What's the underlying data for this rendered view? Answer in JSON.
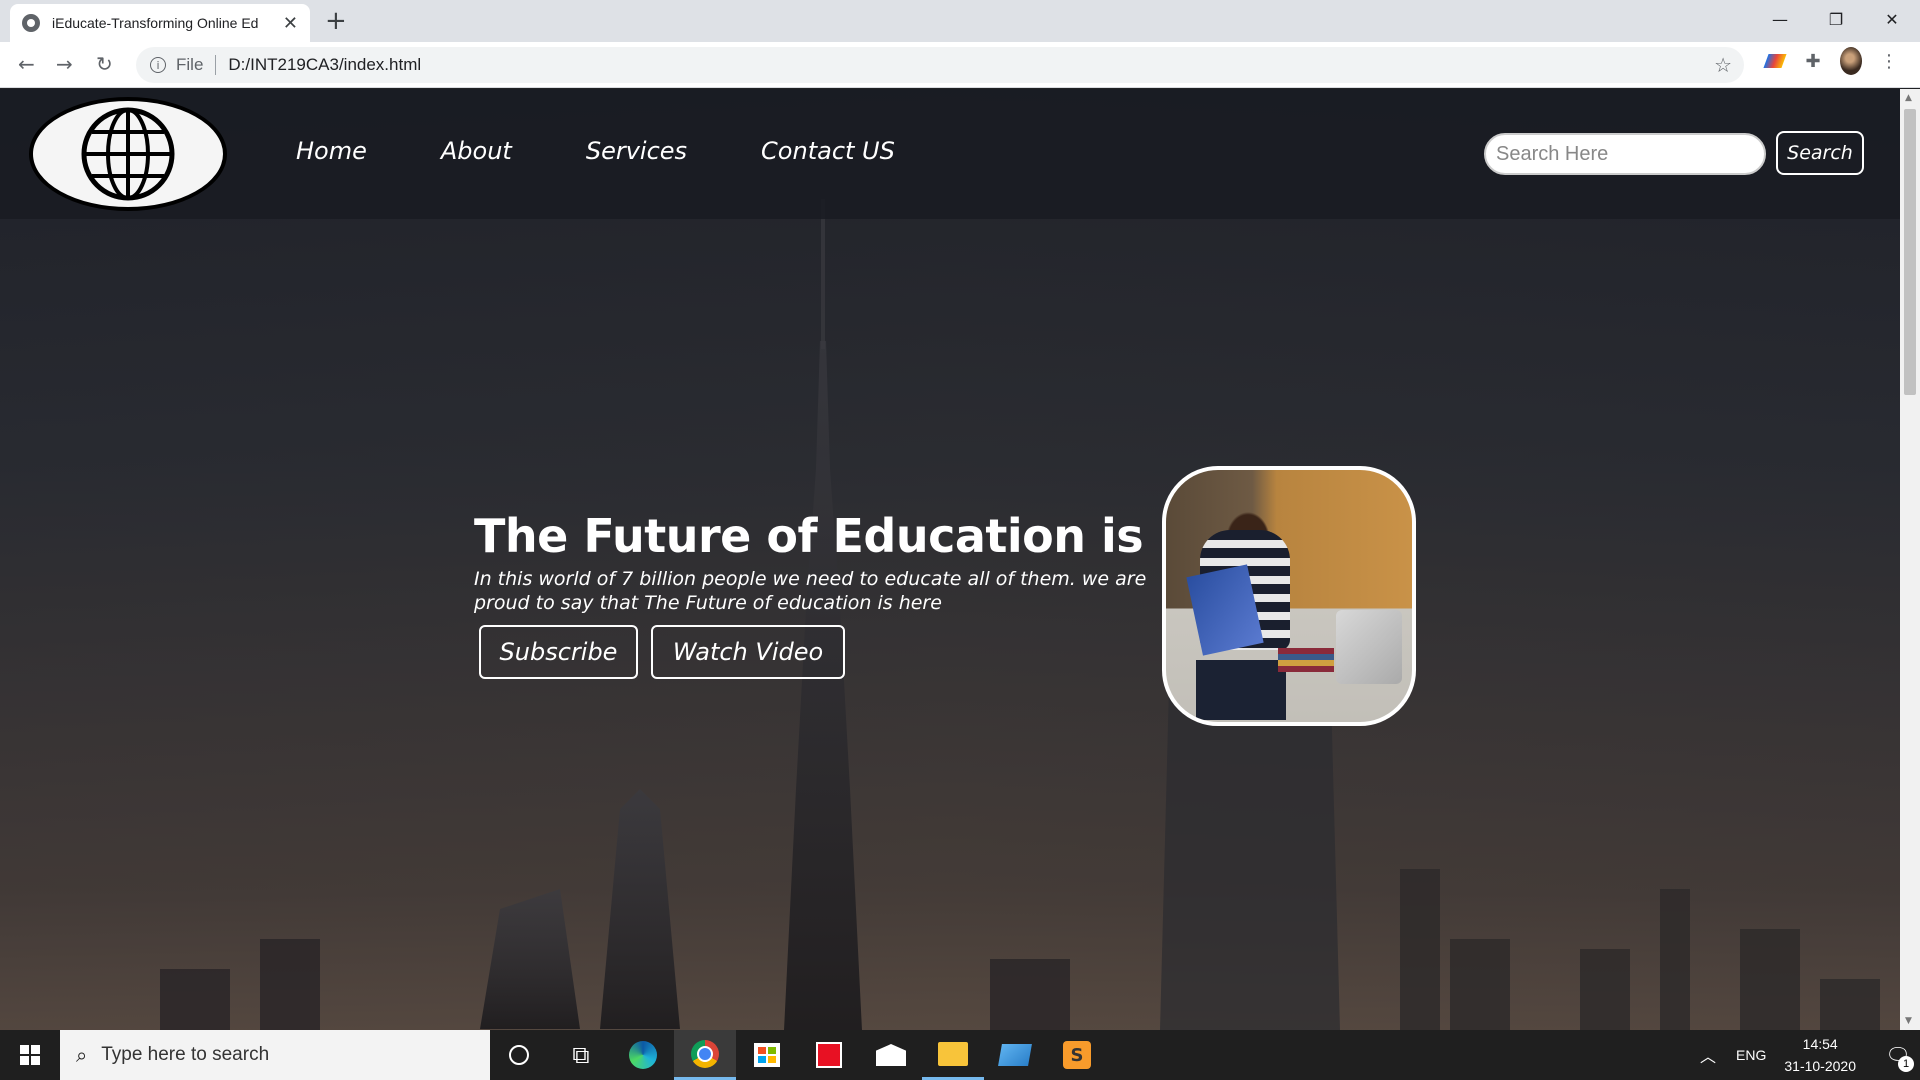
{
  "browser": {
    "tab_title": "iEducate-Transforming Online Ed",
    "tab_close": "✕",
    "new_tab": "+",
    "url_scheme": "File",
    "url": "D:/INT219CA3/index.html",
    "window_controls": {
      "minimize": "—",
      "maximize": "❐",
      "close": "✕"
    }
  },
  "site": {
    "nav": [
      "Home",
      "About",
      "Services",
      "Contact US"
    ],
    "search_placeholder": "Search Here",
    "search_button": "Search"
  },
  "hero": {
    "title": "The Future of Education is here!",
    "subtitle": "In this world of 7 billion people we need to educate all of them. we are proud to say that The Future of education is here",
    "subscribe_button": "Subscribe",
    "watch_button": "Watch Video"
  },
  "taskbar": {
    "search_placeholder": "Type here to search",
    "language": "ENG",
    "time": "14:54",
    "date": "31-10-2020",
    "notifications": "1"
  },
  "colors": {
    "header_bg": "#191b22",
    "taskbar_bg": "#1f1f1f",
    "accent": "#ffffff"
  }
}
